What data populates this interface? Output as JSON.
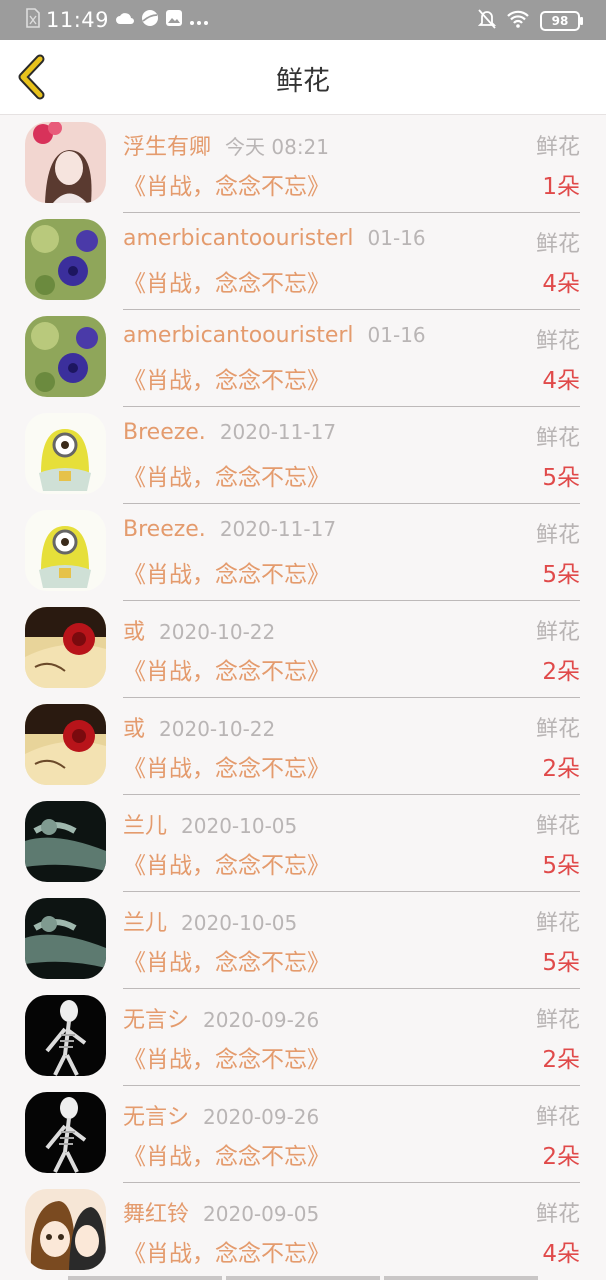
{
  "status_bar": {
    "time": "11:49",
    "battery": "98",
    "icons": [
      "sim-icon",
      "cloud-icon",
      "planet-icon",
      "gallery-icon",
      "more-icon",
      "mute-icon",
      "wifi-icon",
      "battery-icon"
    ]
  },
  "header": {
    "title": "鲜花",
    "back_icon": "back-chevron-icon"
  },
  "gifts": [
    {
      "name": "浮生有卿",
      "date": "今天 08:21",
      "type": "鲜花",
      "book": "《肖战，念念不忘》",
      "count": "1朵",
      "avatar": "girl-portrait"
    },
    {
      "name": "amerbicantoouristerl",
      "date": "01-16",
      "type": "鲜花",
      "book": "《肖战，念念不忘》",
      "count": "4朵",
      "avatar": "purple-flowers"
    },
    {
      "name": "amerbicantoouristerl",
      "date": "01-16",
      "type": "鲜花",
      "book": "《肖战，念念不忘》",
      "count": "4朵",
      "avatar": "purple-flowers"
    },
    {
      "name": "Breeze.",
      "date": "2020-11-17",
      "type": "鲜花",
      "book": "《肖战，念念不忘》",
      "count": "5朵",
      "avatar": "minion"
    },
    {
      "name": "Breeze.",
      "date": "2020-11-17",
      "type": "鲜花",
      "book": "《肖战，念念不忘》",
      "count": "5朵",
      "avatar": "minion"
    },
    {
      "name": "或",
      "date": "2020-10-22",
      "type": "鲜花",
      "book": "《肖战，念念不忘》",
      "count": "2朵",
      "avatar": "red-rose"
    },
    {
      "name": "或",
      "date": "2020-10-22",
      "type": "鲜花",
      "book": "《肖战，念念不忘》",
      "count": "2朵",
      "avatar": "red-rose"
    },
    {
      "name": "兰儿",
      "date": "2020-10-05",
      "type": "鲜花",
      "book": "《肖战，念念不忘》",
      "count": "5朵",
      "avatar": "dark-photo"
    },
    {
      "name": "兰儿",
      "date": "2020-10-05",
      "type": "鲜花",
      "book": "《肖战，念念不忘》",
      "count": "5朵",
      "avatar": "dark-photo"
    },
    {
      "name": "无言シ",
      "date": "2020-09-26",
      "type": "鲜花",
      "book": "《肖战，念念不忘》",
      "count": "2朵",
      "avatar": "skeleton"
    },
    {
      "name": "无言シ",
      "date": "2020-09-26",
      "type": "鲜花",
      "book": "《肖战，念念不忘》",
      "count": "2朵",
      "avatar": "skeleton"
    },
    {
      "name": "舞红铃",
      "date": "2020-09-05",
      "type": "鲜花",
      "book": "《肖战，念念不忘》",
      "count": "4朵",
      "avatar": "anime-girls"
    }
  ],
  "colors": {
    "name": "#e49b6d",
    "date": "#b9b5b5",
    "count": "#e04a4a",
    "back_icon": "#e8c21c"
  }
}
